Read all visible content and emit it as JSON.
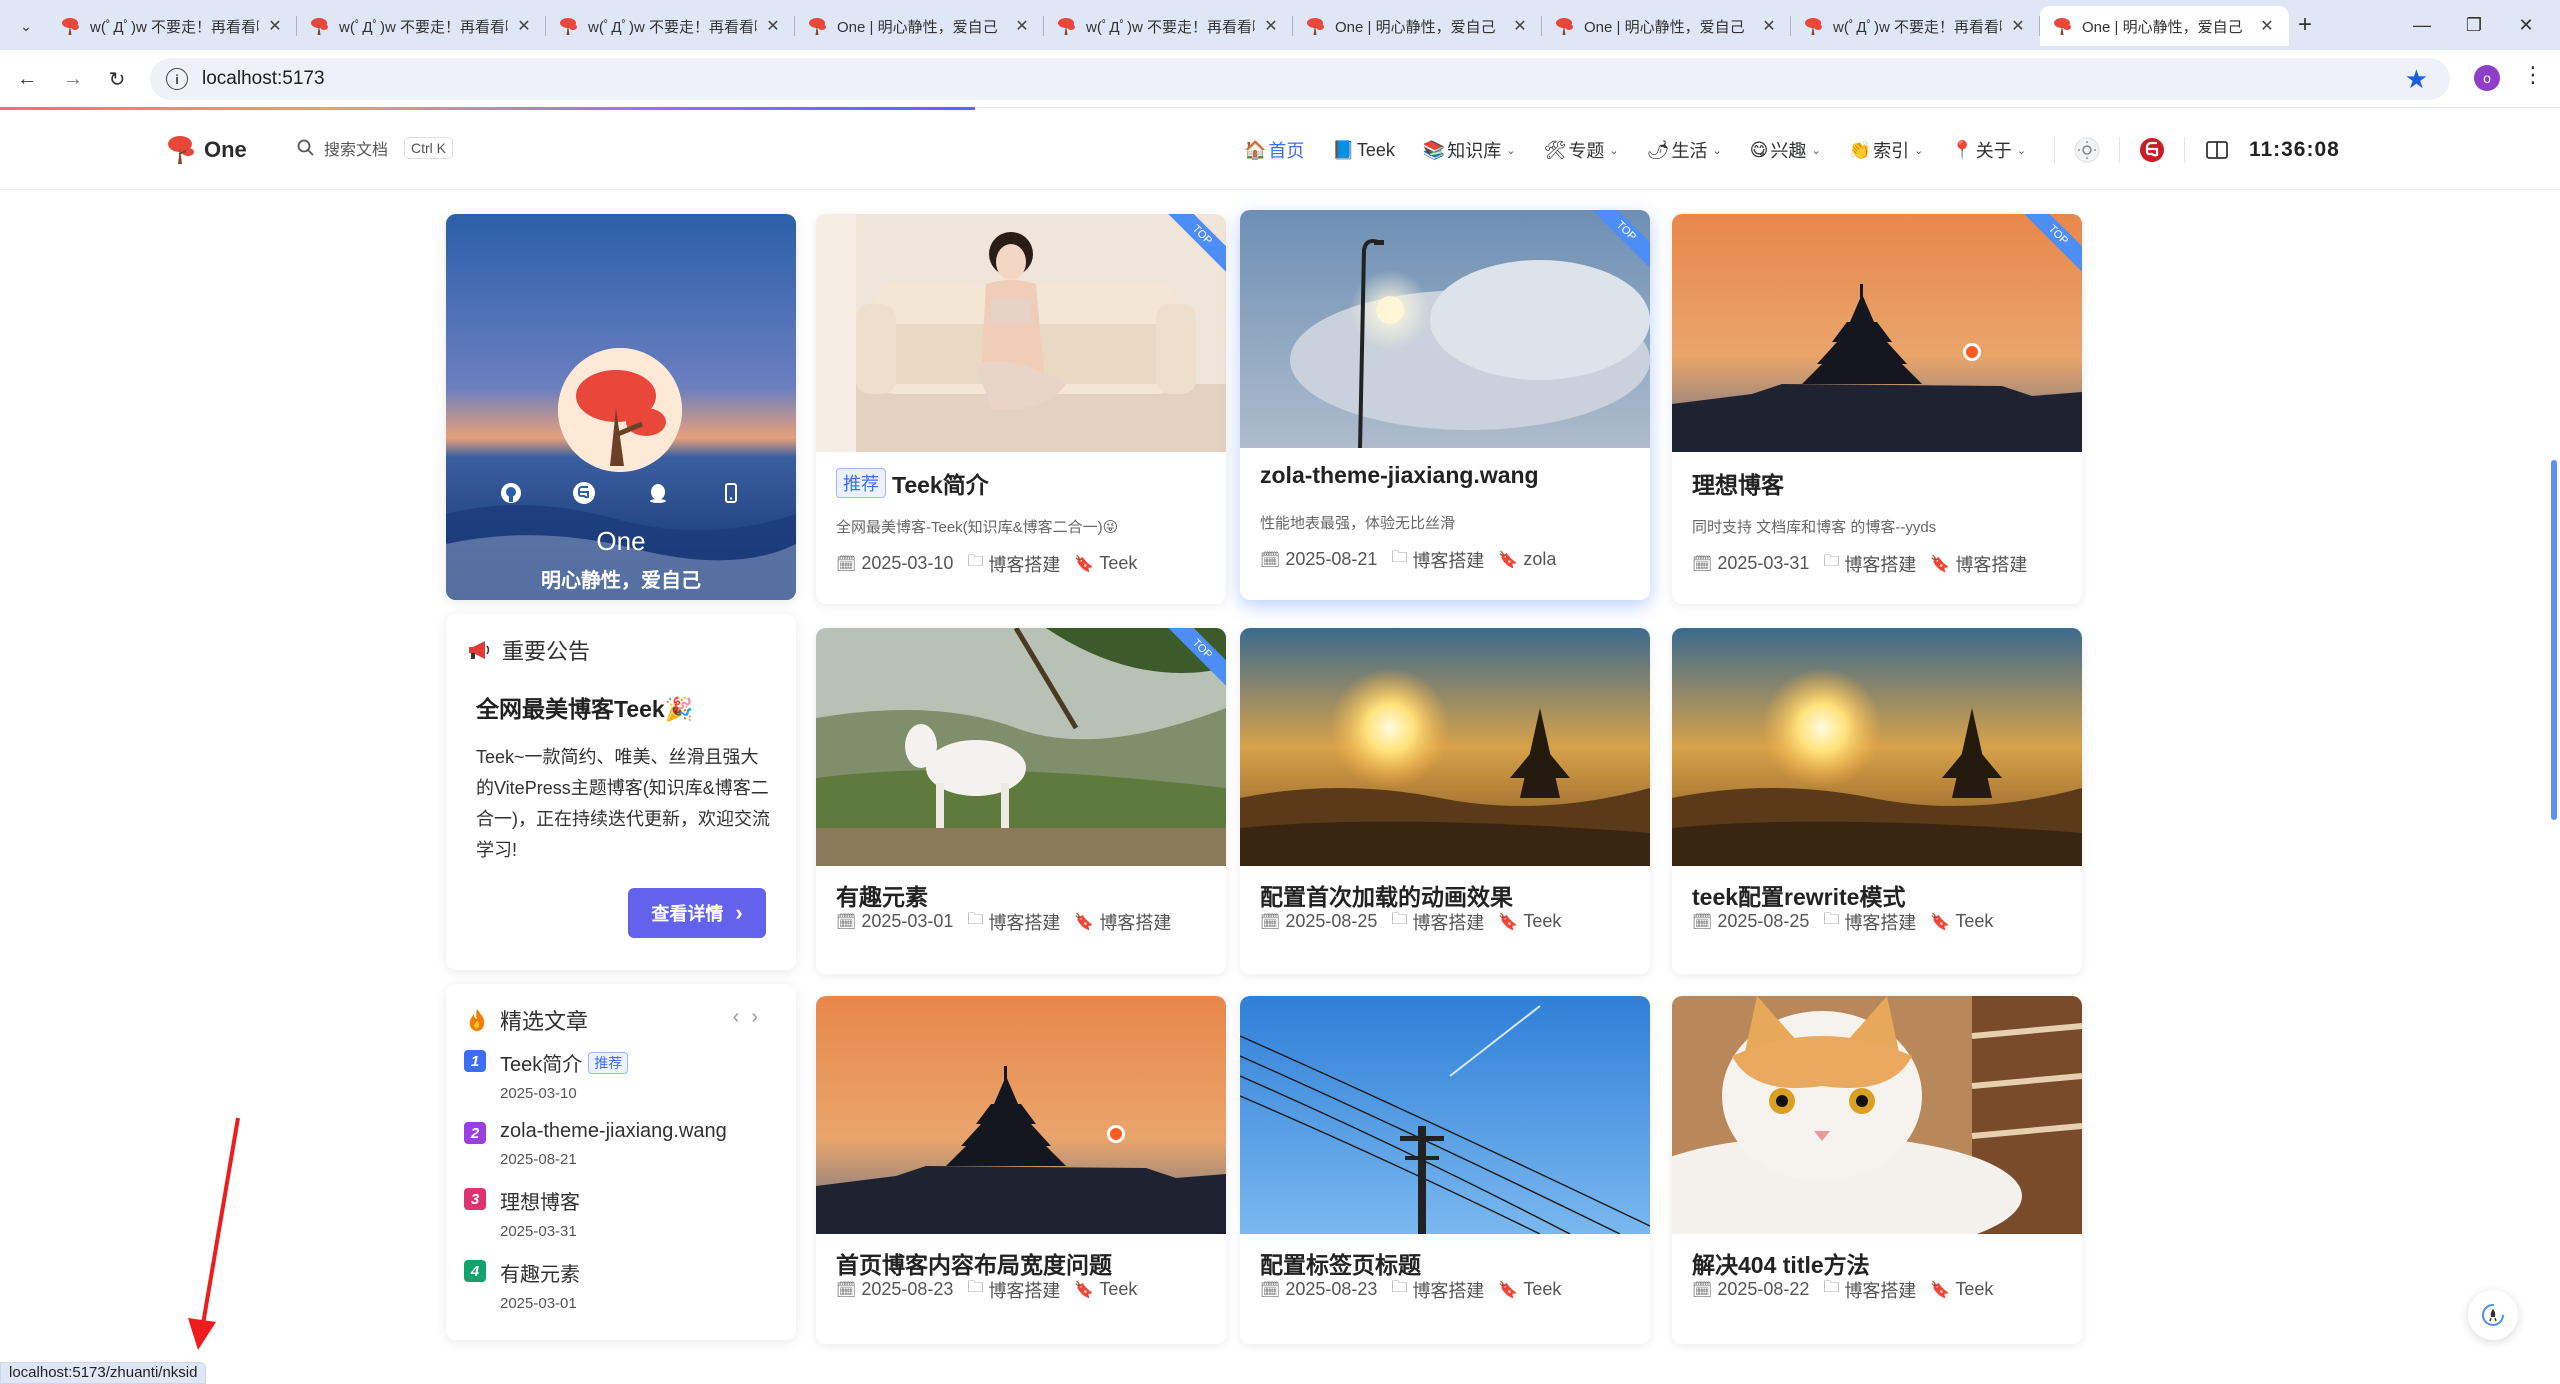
{
  "browser": {
    "tabs": [
      {
        "title": "w(ﾟДﾟ)w 不要走！再看看嘛！",
        "active": false
      },
      {
        "title": "w(ﾟДﾟ)w 不要走！再看看嘛！",
        "active": false
      },
      {
        "title": "w(ﾟДﾟ)w 不要走！再看看嘛！",
        "active": false
      },
      {
        "title": "One | 明心静性，爱自己",
        "active": false
      },
      {
        "title": "w(ﾟДﾟ)w 不要走！再看看嘛！",
        "active": false
      },
      {
        "title": "One | 明心静性，爱自己",
        "active": false
      },
      {
        "title": "One | 明心静性，爱自己",
        "active": false
      },
      {
        "title": "w(ﾟДﾟ)w 不要走！再看看嘛！",
        "active": false
      },
      {
        "title": "One | 明心静性，爱自己",
        "active": true
      }
    ],
    "url": "localhost:5173",
    "profile_initial": "o",
    "status_url": "localhost:5173/zhuanti/nksid"
  },
  "site": {
    "logo_text": "One",
    "search_label": "搜索文档",
    "search_kbd": "Ctrl K",
    "menu": [
      {
        "emoji": "🏠",
        "label": "首页",
        "dropdown": false,
        "active": true
      },
      {
        "emoji": "📘",
        "label": "Teek",
        "dropdown": false,
        "active": false
      },
      {
        "emoji": "📚",
        "label": "知识库",
        "dropdown": true,
        "active": false
      },
      {
        "emoji": "🛠",
        "label": "专题",
        "dropdown": true,
        "active": false
      },
      {
        "emoji": "🌶",
        "label": "生活",
        "dropdown": true,
        "active": false
      },
      {
        "emoji": "😋",
        "label": "兴趣",
        "dropdown": true,
        "active": false
      },
      {
        "emoji": "👏",
        "label": "索引",
        "dropdown": true,
        "active": false
      },
      {
        "emoji": "📍",
        "label": "关于",
        "dropdown": true,
        "active": false
      }
    ],
    "clock": "11:36:08"
  },
  "profile": {
    "name": "One",
    "motto": "明心静性，爱自己",
    "socials": [
      "github-icon",
      "gitee-icon",
      "qq-icon",
      "phone-icon"
    ]
  },
  "notice": {
    "section_title": "重要公告",
    "headline": "全网最美博客Teek🎉",
    "body": "Teek~一款简约、唯美、丝滑且强大的VitePress主题博客(知识库&博客二合一)，正在持续迭代更新，欢迎交流学习!",
    "button_label": "查看详情",
    "button_arrow": "›"
  },
  "featured": {
    "section_title": "精选文章",
    "prev": "‹",
    "next": "›",
    "items": [
      {
        "num": "1",
        "title": "Teek简介",
        "tag": "推荐",
        "date": "2025-03-10",
        "color": "#3c6ef5"
      },
      {
        "num": "2",
        "title": "zola-theme-jiaxiang.wang",
        "tag": "",
        "date": "2025-08-21",
        "color": "#9c3fe0"
      },
      {
        "num": "3",
        "title": "理想博客",
        "tag": "",
        "date": "2025-03-31",
        "color": "#e0326e"
      },
      {
        "num": "4",
        "title": "有趣元素",
        "tag": "",
        "date": "2025-03-01",
        "color": "#10a36a"
      }
    ]
  },
  "posts": [
    {
      "title": "Teek简介",
      "tag": "推荐",
      "desc": "全网最美博客-Teek(知识库&博客二合一)😜",
      "date": "2025-03-10",
      "category": "博客搭建",
      "label": "Teek",
      "top": "TOP",
      "cover": "room"
    },
    {
      "title": "zola-theme-jiaxiang.wang",
      "tag": "",
      "desc": "性能地表最强，体验无比丝滑",
      "date": "2025-08-21",
      "category": "博客搭建",
      "label": "zola",
      "top": "TOP",
      "cover": "sky"
    },
    {
      "title": "理想博客",
      "tag": "",
      "desc": "同时支持 文档库和博客 的博客--yyds",
      "date": "2025-03-31",
      "category": "博客搭建",
      "label": "博客搭建",
      "top": "TOP",
      "cover": "pagoda"
    },
    {
      "title": "有趣元素",
      "tag": "",
      "desc": "",
      "date": "2025-03-01",
      "category": "博客搭建",
      "label": "博客搭建",
      "top": "TOP",
      "cover": "goat"
    },
    {
      "title": "配置首次加载的动画效果",
      "tag": "",
      "desc": "",
      "date": "2025-08-25",
      "category": "博客搭建",
      "label": "Teek",
      "top": "",
      "cover": "sunset"
    },
    {
      "title": "teek配置rewrite模式",
      "tag": "",
      "desc": "",
      "date": "2025-08-25",
      "category": "博客搭建",
      "label": "Teek",
      "top": "",
      "cover": "sunset"
    },
    {
      "title": "首页博客内容布局宽度问题",
      "tag": "",
      "desc": "",
      "date": "2025-08-23",
      "category": "博客搭建",
      "label": "Teek",
      "top": "",
      "cover": "pagoda"
    },
    {
      "title": "配置标签页标题",
      "tag": "",
      "desc": "",
      "date": "2025-08-23",
      "category": "博客搭建",
      "label": "Teek",
      "top": "",
      "cover": "pole"
    },
    {
      "title": "解决404 title方法",
      "tag": "",
      "desc": "",
      "date": "2025-08-22",
      "category": "博客搭建",
      "label": "Teek",
      "top": "",
      "cover": "cat"
    }
  ]
}
